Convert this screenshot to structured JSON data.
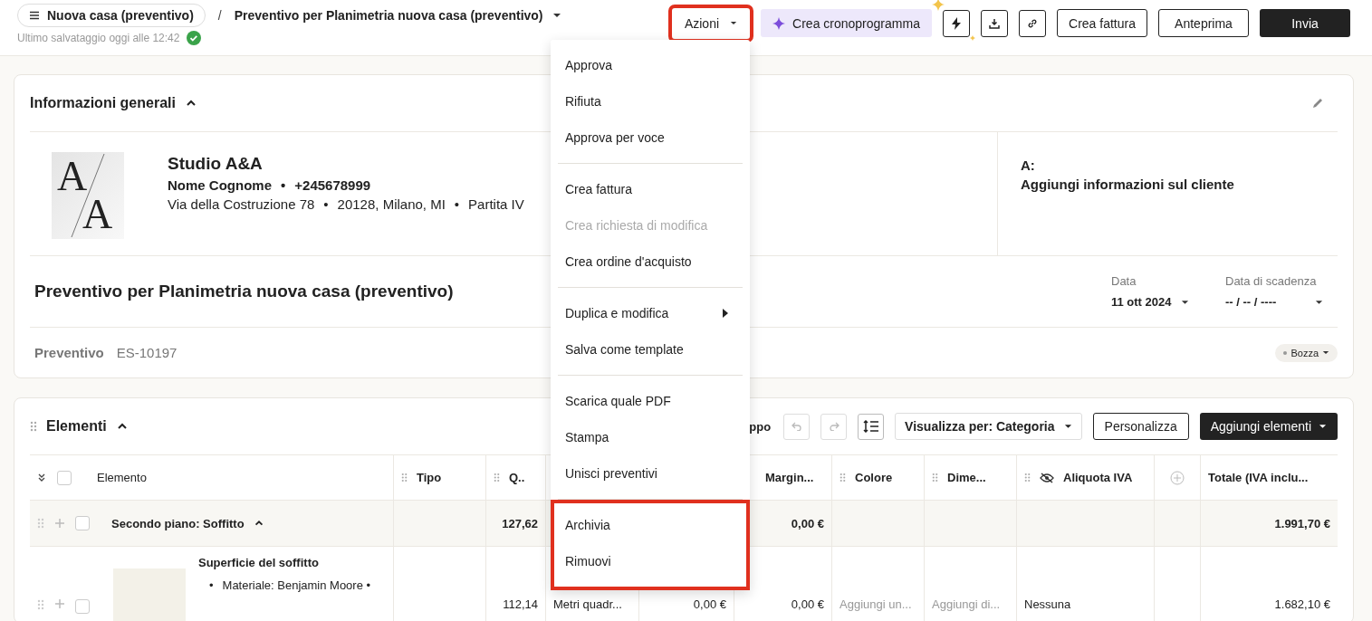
{
  "header": {
    "breadcrumb": "Nuova casa (preventivo)",
    "separator": "/",
    "title": "Preventivo per Planimetria nuova casa (preventivo)",
    "saved": "Ultimo salvataggio oggi alle 12:42"
  },
  "actions": [
    {
      "kind": "menu",
      "label": "Azioni",
      "highlighted": true
    },
    {
      "kind": "ai",
      "label": "Crea cronoprogramma",
      "highlighted": false
    },
    {
      "kind": "icons",
      "highlighted": false
    },
    {
      "kind": "outline",
      "label": "Crea fattura",
      "highlighted": false
    },
    {
      "kind": "outline",
      "label": "Anteprima",
      "highlighted": false
    },
    {
      "kind": "primary",
      "label": "Invia",
      "highlighted": false
    }
  ],
  "menu": {
    "sections": [
      {
        "highlighted": false,
        "items": [
          {
            "label": "Approva",
            "disabled": false,
            "submenu": false
          },
          {
            "label": "Rifiuta",
            "disabled": false,
            "submenu": false
          },
          {
            "label": "Approva per voce",
            "disabled": false,
            "submenu": false
          }
        ]
      },
      {
        "highlighted": false,
        "items": [
          {
            "label": "Crea fattura",
            "disabled": false,
            "submenu": false
          },
          {
            "label": "Crea richiesta di modifica",
            "disabled": true,
            "submenu": false
          },
          {
            "label": "Crea ordine d'acquisto",
            "disabled": false,
            "submenu": false
          }
        ]
      },
      {
        "highlighted": false,
        "items": [
          {
            "label": "Duplica e modifica",
            "disabled": false,
            "submenu": true
          },
          {
            "label": "Salva come template",
            "disabled": false,
            "submenu": false
          }
        ]
      },
      {
        "highlighted": false,
        "items": [
          {
            "label": "Scarica quale PDF",
            "disabled": false,
            "submenu": false
          },
          {
            "label": "Stampa",
            "disabled": false,
            "submenu": false
          },
          {
            "label": "Unisci preventivi",
            "disabled": false,
            "submenu": false
          }
        ]
      },
      {
        "highlighted": true,
        "items": [
          {
            "label": "Archivia",
            "disabled": false,
            "submenu": false
          },
          {
            "label": "Rimuovi",
            "disabled": false,
            "submenu": false
          }
        ]
      }
    ]
  },
  "info": {
    "title": "Informazioni generali",
    "expanded": true,
    "logo": {
      "letters": [
        "A",
        "A"
      ]
    },
    "company": {
      "name": "Studio A&A",
      "contact": [
        "Nome Cognome",
        "•",
        "+245678999"
      ],
      "address": [
        "Via della Costruzione 78",
        "•",
        "20128, Milano, MI",
        "•",
        "Partita IV"
      ]
    },
    "client": {
      "label": "A:",
      "placeholder": "Aggiungi informazioni sul cliente"
    },
    "doc_title": "Preventivo per Planimetria nuova casa (preventivo)",
    "dates": [
      {
        "label": "Data",
        "value": "11 ott 2024"
      },
      {
        "label": "Data di scadenza",
        "value": "-- / -- / ----"
      }
    ],
    "doc_type": "Preventivo",
    "number": "ES-10197",
    "status": "Bozza"
  },
  "elements": {
    "title": "Elementi",
    "expanded": true,
    "toolbar_text": "ppo",
    "view": "Visualizza per: Categoria",
    "customize": "Personalizza",
    "add": "Aggiungi elementi",
    "all_checked": false,
    "columns": [
      {
        "label": "Elemento",
        "grip": false,
        "hidden": false
      },
      {
        "label": "Tipo",
        "grip": true,
        "hidden": false
      },
      {
        "label": "Q..",
        "grip": true,
        "hidden": false
      },
      null,
      null,
      {
        "label": "Margin...",
        "grip": false,
        "hidden": false
      },
      {
        "label": "Colore",
        "grip": true,
        "hidden": false
      },
      {
        "label": "Dime...",
        "grip": true,
        "hidden": false
      },
      {
        "label": "Aliquota IVA",
        "grip": true,
        "hidden": true
      },
      {
        "kind": "add",
        "grip": false,
        "hidden": false
      },
      {
        "label": "Totale (IVA inclu...",
        "grip": false,
        "hidden": false
      }
    ],
    "rows": [
      {
        "kind": "group",
        "name": "Secondo piano: Soffitto",
        "expanded": true,
        "checked": false,
        "cells": [
          null,
          null,
          "127,62",
          null,
          null,
          "0,00 €",
          null,
          null,
          null,
          null,
          "1.991,70 €"
        ]
      },
      {
        "kind": "item",
        "name": "Superficie del soffitto",
        "bullets": [
          {
            "mark": "•",
            "text": "Materiale: Benjamin Moore •"
          }
        ],
        "checked": false,
        "cells": [
          null,
          null,
          "112,14",
          "Metri quadr...",
          "0,00 €",
          "0,00 €",
          {
            "placeholder": "Aggiungi un..."
          },
          {
            "placeholder": "Aggiungi di..."
          },
          "Nessuna",
          null,
          "1.682,10 €"
        ]
      }
    ]
  }
}
